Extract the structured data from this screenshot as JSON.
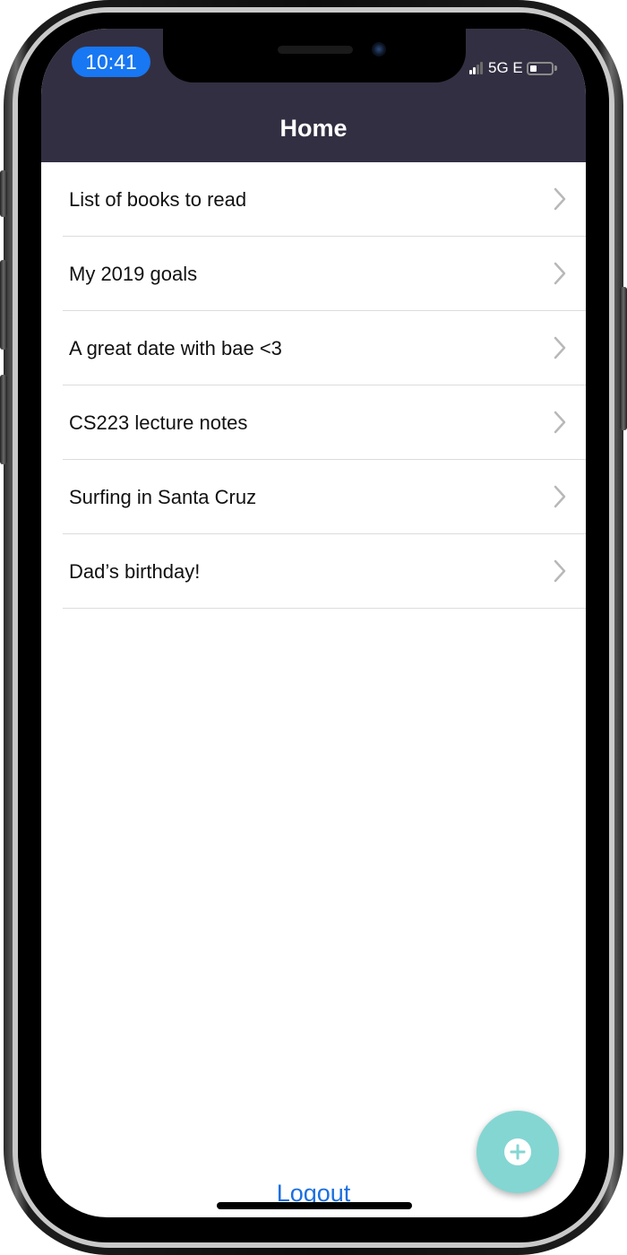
{
  "status_bar": {
    "time": "10:41",
    "network": "5G E",
    "signal_bars_active": 2,
    "signal_bars_total": 4,
    "battery_level": 0.3
  },
  "header": {
    "title": "Home",
    "background_color": "#332f42"
  },
  "list": {
    "items": [
      {
        "label": "List of books to read"
      },
      {
        "label": "My 2019 goals"
      },
      {
        "label": "A great date with bae <3"
      },
      {
        "label": "CS223 lecture notes"
      },
      {
        "label": "Surfing in Santa Cruz"
      },
      {
        "label": "Dad’s birthday!"
      }
    ],
    "chevron_icon": "chevron-right-icon"
  },
  "footer": {
    "logout_label": "Logout",
    "logout_color": "#1b6fe0"
  },
  "fab": {
    "icon": "plus-circle-icon",
    "color": "#84d6d3"
  }
}
